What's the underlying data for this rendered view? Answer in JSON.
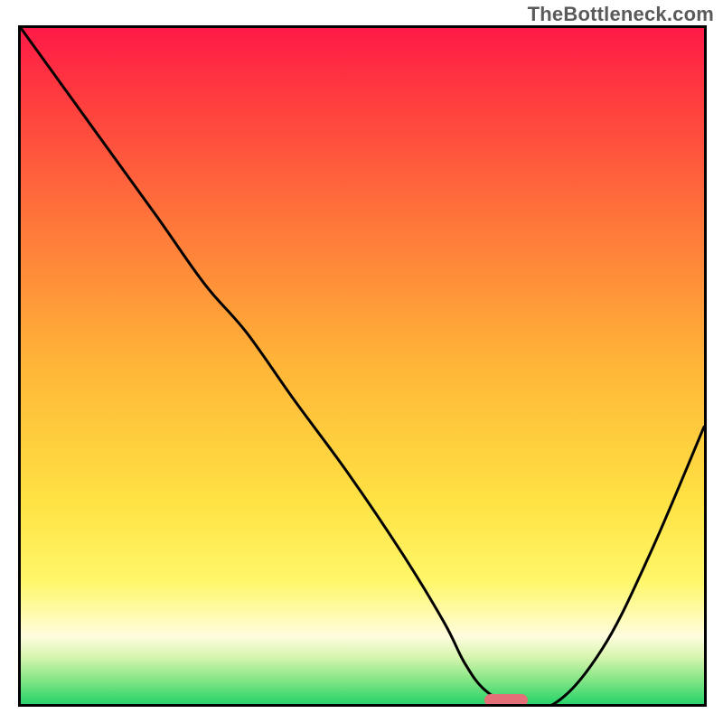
{
  "watermark": "TheBottleneck.com",
  "chart_data": {
    "type": "line",
    "title": "",
    "xlabel": "",
    "ylabel": "",
    "xlim": [
      0,
      100
    ],
    "ylim": [
      0,
      100
    ],
    "x": [
      0,
      10,
      20,
      27,
      33,
      40,
      48,
      56,
      62,
      65,
      68,
      72,
      78,
      85,
      92,
      100
    ],
    "y": [
      100,
      86,
      72,
      62,
      55,
      45,
      34,
      22,
      12,
      6,
      2,
      0,
      0,
      8,
      22,
      41
    ],
    "marker": {
      "x": 71,
      "y": 0,
      "color": "#e36f78"
    },
    "grid": false,
    "legend": false
  },
  "plot": {
    "inner_w": 756,
    "inner_h": 748
  }
}
